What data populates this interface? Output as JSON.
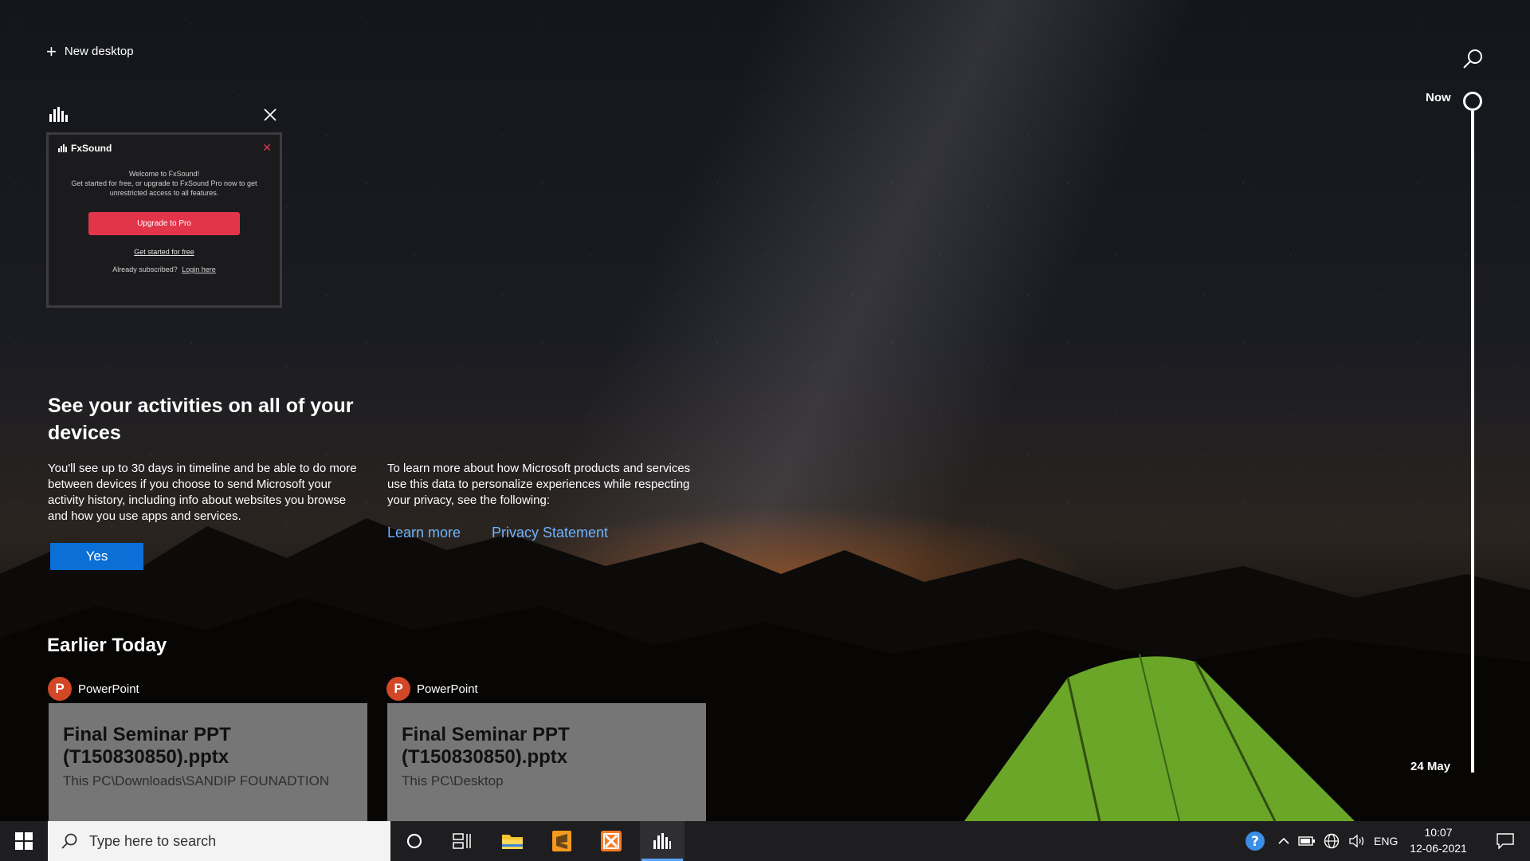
{
  "header": {
    "new_desktop_label": "New desktop"
  },
  "timeline": {
    "top_label": "Now",
    "bottom_label": "24 May"
  },
  "window": {
    "app_name": "FxSound",
    "welcome_line1": "Welcome to FxSound!",
    "welcome_line2": "Get started for free, or upgrade to FxSound Pro now to get unrestricted access to all features.",
    "upgrade_label": "Upgrade to Pro",
    "free_label": "Get started for free",
    "already_text": "Already subscribed?",
    "login_label": "Login here"
  },
  "activities": {
    "title": "See your activities on all of your devices",
    "paragraph1": "You'll see up to 30 days in timeline and be able to do more between devices if you choose to send Microsoft your activity history, including info about websites you browse and how you use apps and services.",
    "paragraph2": "To learn more about how Microsoft products and services use this data to personalize experiences while respecting your privacy, see the following:",
    "yes_label": "Yes",
    "learn_more_label": "Learn more",
    "privacy_label": "Privacy Statement"
  },
  "earlier": {
    "heading": "Earlier Today",
    "items": [
      {
        "app": "PowerPoint",
        "title": "Final Seminar PPT (T150830850).pptx",
        "path": "This PC\\Downloads\\SANDIP FOUNADTION"
      },
      {
        "app": "PowerPoint",
        "title": "Final Seminar PPT (T150830850).pptx",
        "path": "This PC\\Desktop"
      }
    ]
  },
  "taskbar": {
    "search_placeholder": "Type here to search",
    "language": "ENG",
    "time": "10:07",
    "date": "12-06-2021"
  },
  "colors": {
    "accent": "#0a6fd6",
    "link": "#6fb3ff",
    "fx_red": "#e3354a",
    "taskbar": "#1e1e21"
  }
}
